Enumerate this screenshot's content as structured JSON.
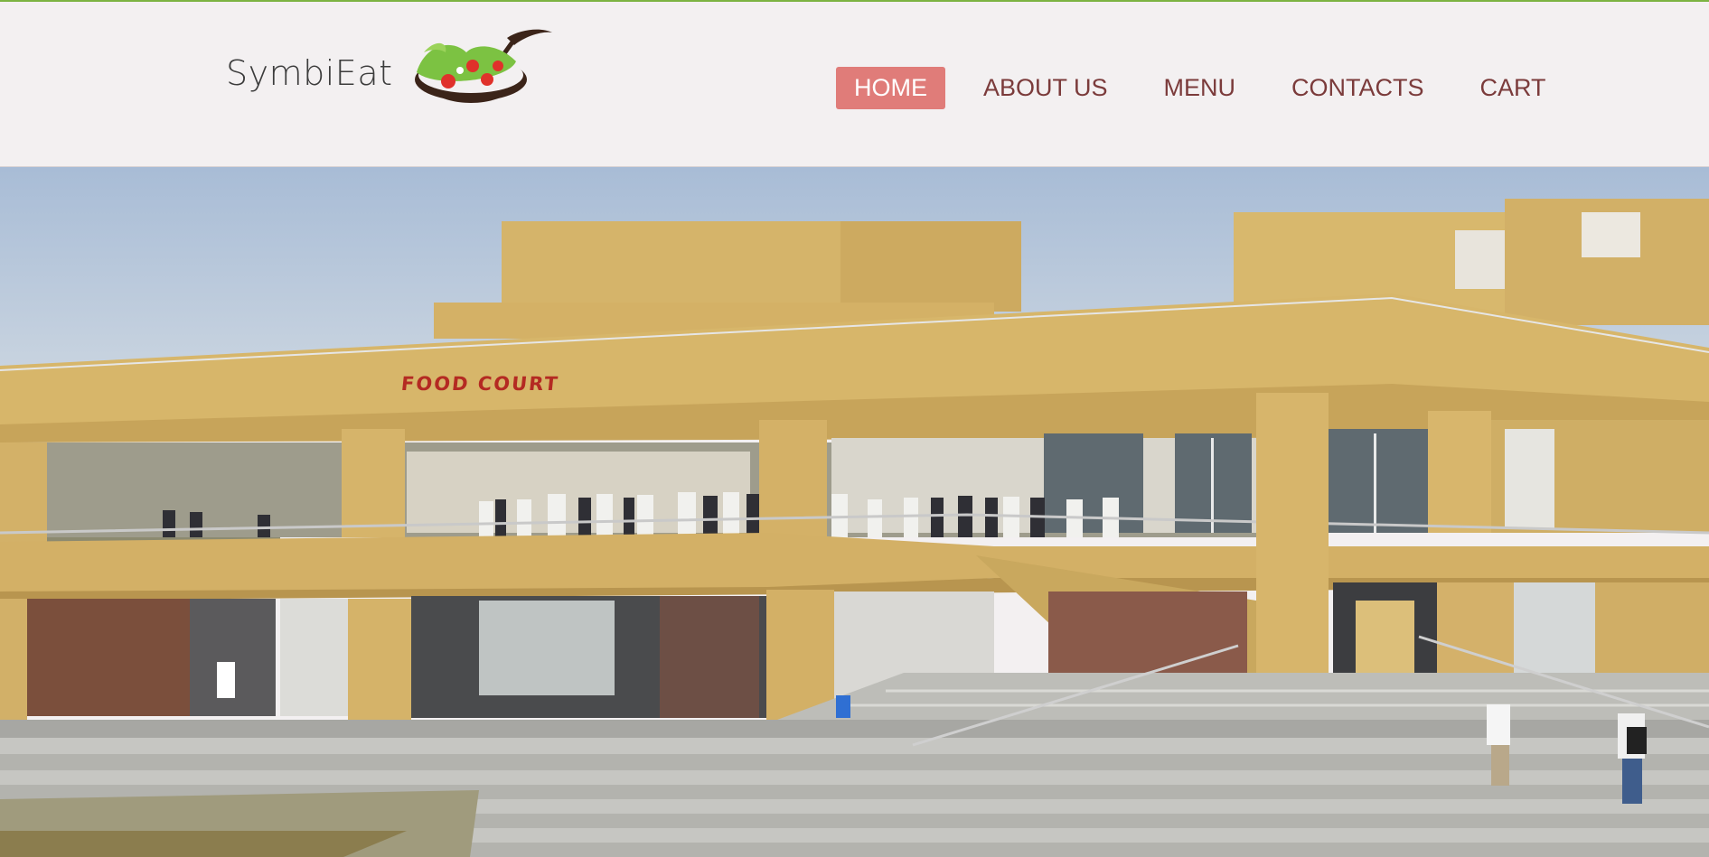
{
  "header": {
    "logo_text": "SymbiEat",
    "nav": [
      {
        "label": "HOME",
        "active": true
      },
      {
        "label": "ABOUT US",
        "active": false
      },
      {
        "label": "MENU",
        "active": false
      },
      {
        "label": "CONTACTS",
        "active": false
      },
      {
        "label": "CART",
        "active": false
      }
    ]
  },
  "hero": {
    "sign_text": "FOOD COURT"
  },
  "colors": {
    "accent_line": "#7cb342",
    "active_nav_bg": "#e07c79",
    "nav_text": "#7b3b3b",
    "header_bg": "#f3f0f1"
  }
}
